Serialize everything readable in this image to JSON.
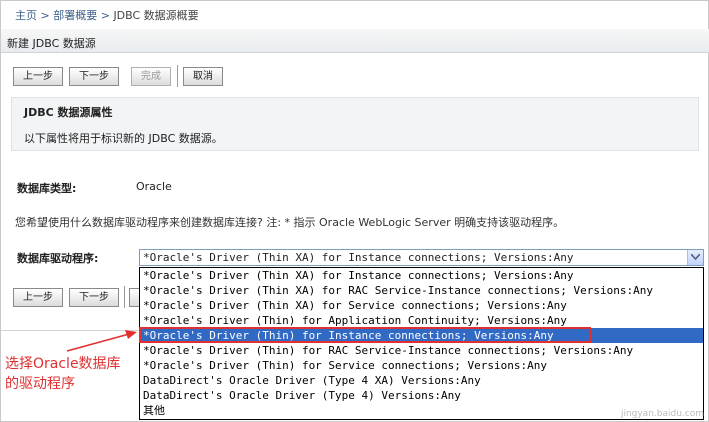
{
  "breadcrumb": {
    "home": "主页",
    "sep1": ">",
    "item1": "部署概要",
    "sep2": ">",
    "current": "JDBC 数据源概要"
  },
  "page": {
    "title": "新建 JDBC 数据源"
  },
  "toolbar": {
    "back": "上一步",
    "next": "下一步",
    "finish": "完成",
    "cancel": "取消"
  },
  "section": {
    "title": "JDBC 数据源属性",
    "description": "以下属性将用于标识新的 JDBC 数据源。"
  },
  "form": {
    "db_type_label": "数据库类型:",
    "db_type_value": "Oracle",
    "question": "您希望使用什么数据库驱动程序来创建数据库连接? 注: * 指示 Oracle WebLogic Server 明确支持该驱动程序。",
    "driver_label": "数据库驱动程序:",
    "driver_selected": "*Oracle's Driver (Thin XA) for Instance connections; Versions:Any"
  },
  "driver_options": [
    "*Oracle's Driver (Thin XA) for Instance connections; Versions:Any",
    "*Oracle's Driver (Thin XA) for RAC Service-Instance connections; Versions:Any",
    "*Oracle's Driver (Thin XA) for Service connections; Versions:Any",
    "*Oracle's Driver (Thin) for Application Continuity; Versions:Any",
    "*Oracle's Driver (Thin) for Instance connections; Versions:Any",
    "*Oracle's Driver (Thin) for RAC Service-Instance connections; Versions:Any",
    "*Oracle's Driver (Thin) for Service connections; Versions:Any",
    "DataDirect's Oracle Driver (Type 4 XA) Versions:Any",
    "DataDirect's Oracle Driver (Type 4) Versions:Any",
    "其他"
  ],
  "highlighted_index": 4,
  "annotation": {
    "line1": "选择Oracle数据库",
    "line2": "的驱动程序"
  },
  "watermark": "jingyan.baidu.com",
  "colors": {
    "selection": "#316ac5",
    "annotation": "#e03030",
    "link": "#3d5f8a"
  }
}
